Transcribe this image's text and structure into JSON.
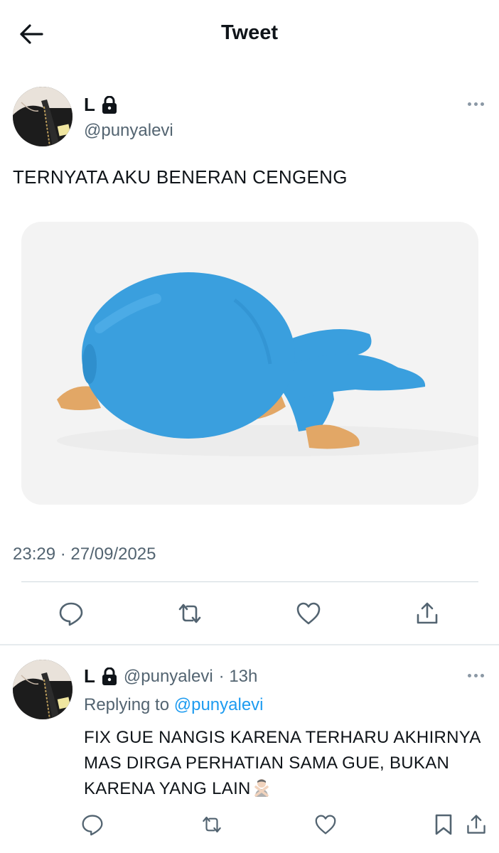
{
  "header": {
    "title": "Tweet"
  },
  "tweet": {
    "author_name": "L",
    "author_handle": "@punyalevi",
    "text": "TERNYATA AKU BENERAN CENGENG",
    "timestamp": "23:29 · 27/09/2025",
    "media": {
      "subject": "blue-character-lying-face-down"
    }
  },
  "reply": {
    "author_name": "L",
    "author_handle": "@punyalevi",
    "time": "· 13h",
    "replying_label": "Replying to",
    "replying_to": "@punyalevi",
    "text": "FIX GUE NANGIS KARENA TERHARU AKHIRNYA MAS DIRGA PERHATIAN SAMA GUE, BUKAN KARENA YANG LAIN"
  },
  "icons": {
    "back": "arrow-left-icon",
    "lock": "lock-icon",
    "more": "more-horizontal-icon",
    "reply": "reply-icon",
    "retweet": "retweet-icon",
    "like": "heart-icon",
    "share": "share-icon",
    "bookmark": "bookmark-icon",
    "emoji": "person-gesturing-no-emoji"
  },
  "colors": {
    "text": "#0f1419",
    "secondary": "#536471",
    "link": "#1d9bf0",
    "divider": "#cfd9de"
  }
}
